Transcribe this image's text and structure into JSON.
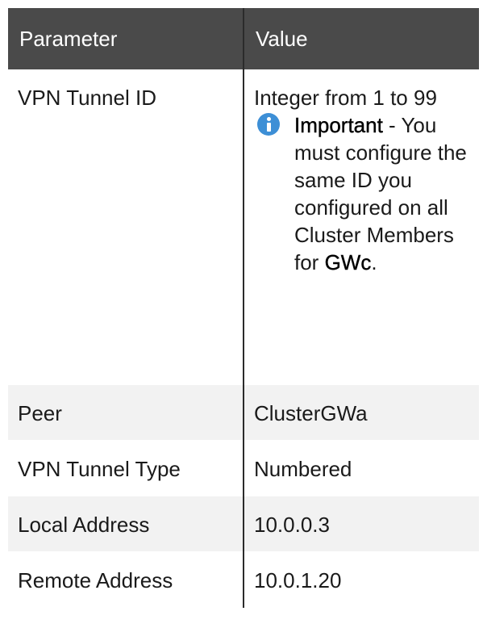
{
  "table": {
    "headers": {
      "parameter": "Parameter",
      "value": "Value"
    },
    "rows": [
      {
        "parameter": "VPN Tunnel ID",
        "value": "Integer from 1 to 99",
        "note": {
          "label": "Important",
          "dash": " - ",
          "text": "You must configure the same ID you configured on all Cluster Members for ",
          "target": "GWc",
          "end": "."
        }
      },
      {
        "parameter": "Peer",
        "value": "ClusterGWa"
      },
      {
        "parameter": "VPN Tunnel Type",
        "value": "Numbered"
      },
      {
        "parameter": "Local Address",
        "value": "10.0.0.3"
      },
      {
        "parameter": "Remote Address",
        "value": "10.0.1.20"
      }
    ]
  },
  "colors": {
    "header_bg": "#4a4a4a",
    "alt_row_bg": "#f2f2f2",
    "info_icon": "#3d8fd6"
  },
  "icons": {
    "note_icon": "info-icon"
  }
}
